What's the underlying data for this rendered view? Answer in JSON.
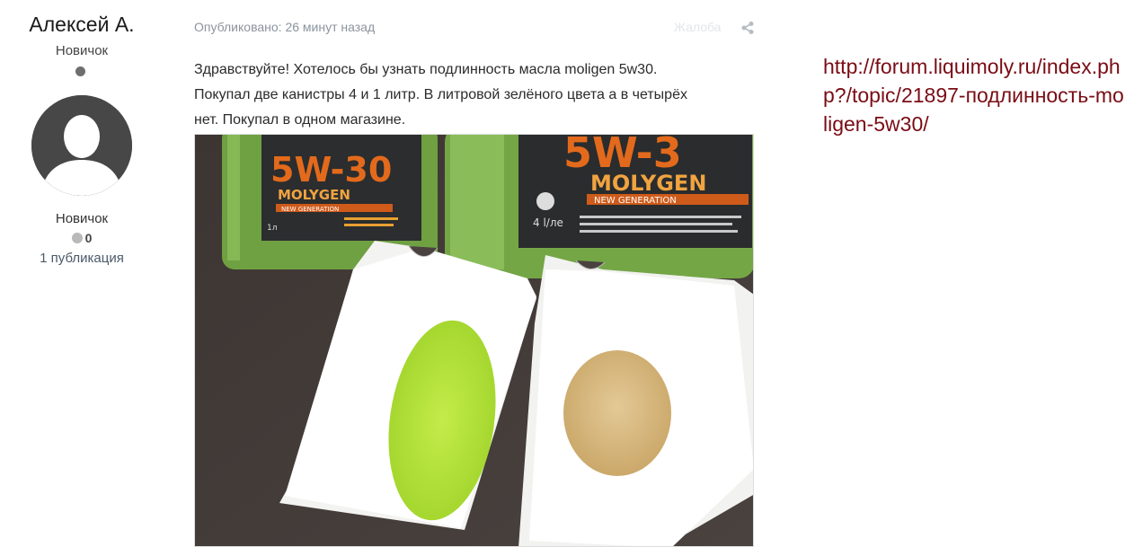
{
  "author": {
    "name": "Алексей А.",
    "rank": "Новичок",
    "group": "Новичок",
    "reputation": "0",
    "posts_count": "1 публикация"
  },
  "post": {
    "published": "Опубликовано: 26 минут назад",
    "report_label": "Жалоба",
    "body_lines": [
      "Здравствуйте! Хотелось бы узнать подлинность масла moligen 5w30.",
      "Покупал две канистры 4 и 1 литр. В литровой зелёного цвета а в четырёх",
      "нет. Покупал в одном магазине."
    ],
    "photo": {
      "left_label": "5W-30",
      "left_brand": "MOLYGEN",
      "left_sub": "NEW GENERATION",
      "left_volume": "1л",
      "right_label": "5W-3",
      "right_brand": "MOLYGEN",
      "right_sub": "NEW GENERATION",
      "right_volume": "4 l/ле"
    }
  },
  "link": {
    "text": "http://forum.liquimoly.ru/index.php?/topic/21897-подлинность-moligen-5w30/"
  },
  "icons": {
    "share": "share-icon",
    "status": "online-status-icon",
    "reputation": "reputation-icon"
  },
  "colors": {
    "link": "#7a0c14",
    "meta": "#8b949e",
    "green_oil": "#b8e03a",
    "amber_oil": "#d6b77e",
    "canister": "#6fa042"
  }
}
